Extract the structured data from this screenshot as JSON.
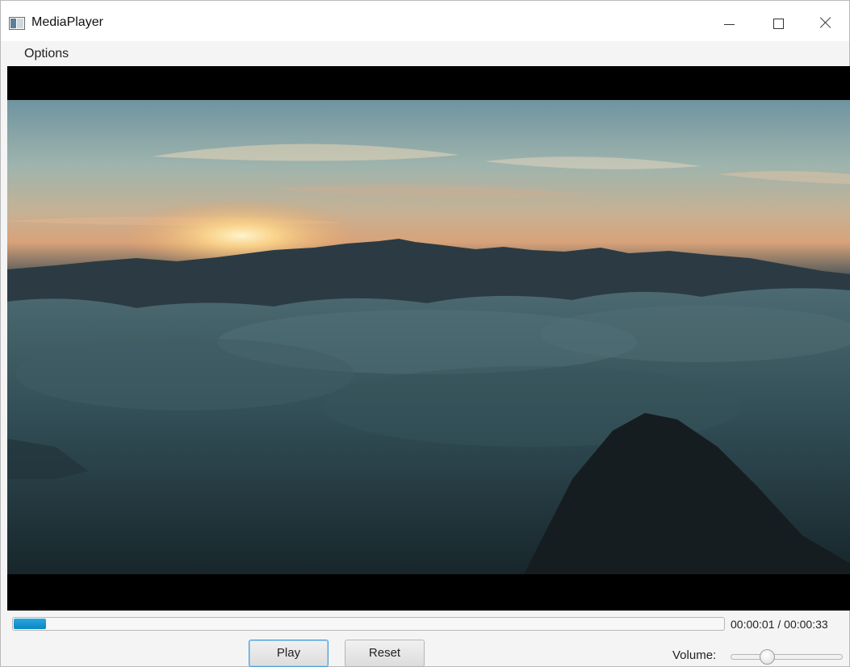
{
  "window": {
    "title": "MediaPlayer",
    "icon": "app-window-icon",
    "controls": {
      "minimize_icon": "minimize-icon",
      "maximize_icon": "maximize-icon",
      "close_icon": "close-icon"
    }
  },
  "menu": {
    "items": [
      {
        "label": "Options"
      }
    ]
  },
  "video": {
    "content": "aerial sunset over mountains and sea of clouds"
  },
  "playback": {
    "current_time": "00:00:01",
    "separator": "/",
    "total_time": "00:00:33",
    "time_display": "00:00:01  /  00:00:33",
    "progress_fraction": 0.045
  },
  "buttons": {
    "play_label": "Play",
    "reset_label": "Reset"
  },
  "volume": {
    "label": "Volume:",
    "level_fraction": 0.3
  },
  "colors": {
    "progress_fill": "#0a88c3",
    "accent_border": "#4a9dd8",
    "video_background": "#000000"
  }
}
